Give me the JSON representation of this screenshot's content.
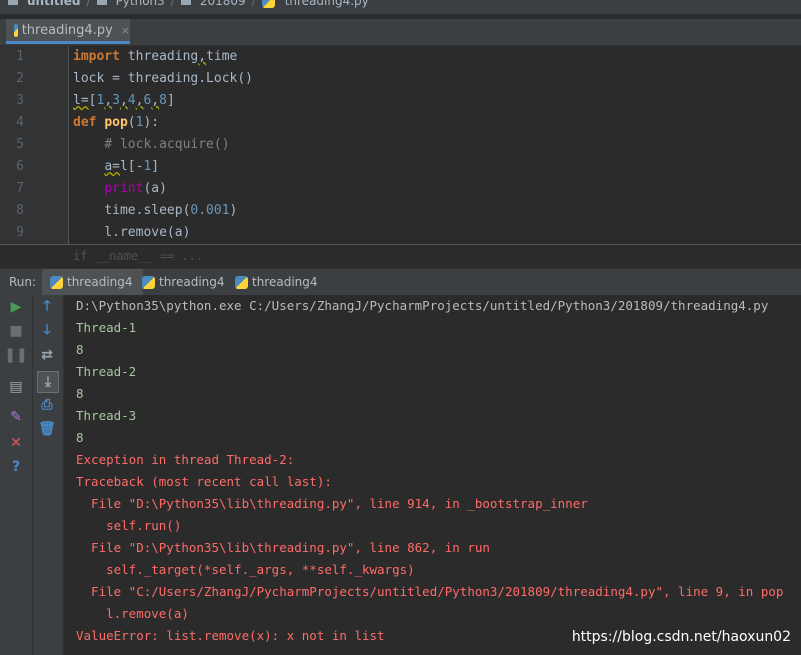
{
  "breadcrumb": [
    "untitled",
    "Python3",
    "201809",
    "threading4.py"
  ],
  "editor_tab": {
    "label": "threading4.py",
    "close": "×"
  },
  "code_lines": [
    {
      "n": "1"
    },
    {
      "n": "2"
    },
    {
      "n": "3"
    },
    {
      "n": "4"
    },
    {
      "n": "5"
    },
    {
      "n": "6"
    },
    {
      "n": "7"
    },
    {
      "n": "8"
    },
    {
      "n": "9"
    }
  ],
  "ghost_line": "if __name__ == ...",
  "run": {
    "label": "Run:",
    "tabs": [
      "threading4",
      "threading4",
      "threading4"
    ]
  },
  "console_lines": [
    "D:\\Python35\\python.exe C:/Users/ZhangJ/PycharmProjects/untitled/Python3/201809/threading4.py",
    "Thread-1",
    "8",
    "Thread-2",
    "8",
    "Thread-3",
    "8",
    "Exception in thread Thread-2:",
    "Traceback (most recent call last):",
    "  File \"D:\\Python35\\lib\\threading.py\", line 914, in _bootstrap_inner",
    "    self.run()",
    "  File \"D:\\Python35\\lib\\threading.py\", line 862, in run",
    "    self._target(*self._args, **self._kwargs)",
    "  File \"C:/Users/ZhangJ/PycharmProjects/untitled/Python3/201809/threading4.py\", line 9, in pop",
    "    l.remove(a)",
    "ValueError: list.remove(x): x not in list"
  ],
  "watermark": "https://blog.csdn.net/haoxun02",
  "colors": {
    "accent": "#4a88c7",
    "error": "#ff6b68",
    "run_green": "#499c54"
  }
}
